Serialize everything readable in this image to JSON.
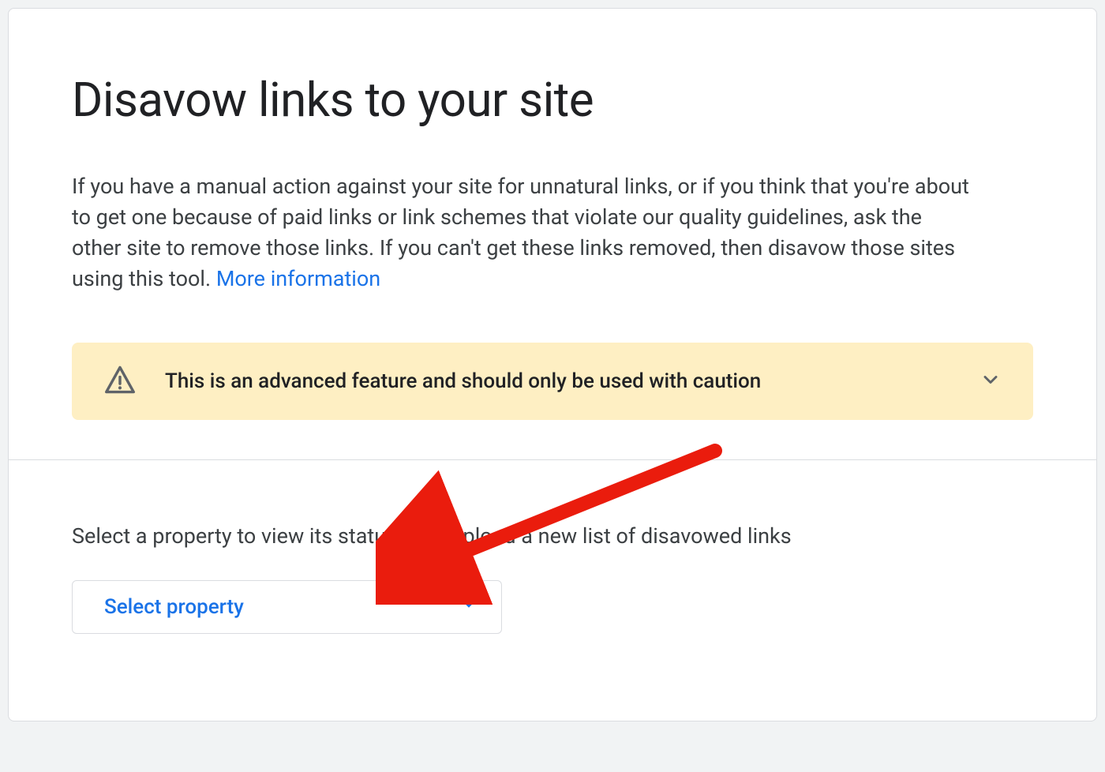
{
  "page": {
    "title": "Disavow links to your site",
    "description_before_link": "If you have a manual action against your site for unnatural links, or if you think that you're about to get one because of paid links or link schemes that violate our quality guidelines, ask the other site to remove those links. If you can't get these links removed, then disavow those sites using this tool. ",
    "more_info_link": "More information"
  },
  "warning": {
    "text": "This is an advanced feature and should only be used with caution"
  },
  "property_section": {
    "instruction": "Select a property to view its status or to upload a new list of disavowed links",
    "dropdown_label": "Select property"
  },
  "annotation": {
    "arrow_color": "#ea1c0d"
  }
}
